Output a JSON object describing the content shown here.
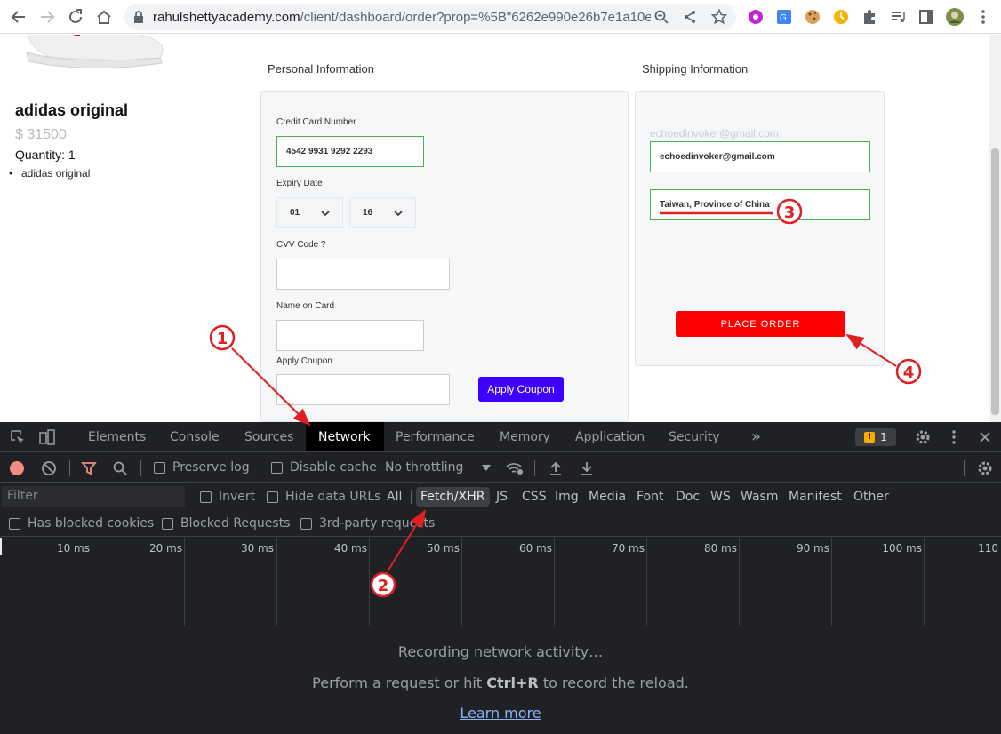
{
  "browser": {
    "url_host": "rahulshettyacademy.com",
    "url_path": "/client/dashboard/order?prop=%5B\"6262e990e26b7e1a10e..."
  },
  "product": {
    "name": "adidas original",
    "price": "$ 31500",
    "quantity": "Quantity: 1",
    "items": [
      "adidas original"
    ]
  },
  "personal": {
    "title": "Personal Information",
    "card_label": "Credit Card Number",
    "card_value": "4542 9931 9292 2293",
    "expiry_label": "Expiry Date",
    "expiry_month": "01",
    "expiry_year": "16",
    "cvv_label": "CVV Code ?",
    "name_label": "Name on Card",
    "coupon_label": "Apply Coupon",
    "apply_button": "Apply Coupon"
  },
  "shipping": {
    "title": "Shipping Information",
    "email_placeholder": "echoedinvoker@gmail.com",
    "email_value": "echoedinvoker@gmail.com",
    "country_value": "Taiwan, Province of China",
    "place_order": "PLACE ORDER"
  },
  "devtools": {
    "tabs": [
      "Elements",
      "Console",
      "Sources",
      "Network",
      "Performance",
      "Memory",
      "Application",
      "Security"
    ],
    "active_tab": "Network",
    "more_tabs": "»",
    "issues_count": "1",
    "preserve_log": "Preserve log",
    "disable_cache": "Disable cache",
    "throttling": "No throttling",
    "filter_placeholder": "Filter",
    "invert": "Invert",
    "hide_data_urls": "Hide data URLs",
    "types": [
      "All",
      "Fetch/XHR",
      "JS",
      "CSS",
      "Img",
      "Media",
      "Font",
      "Doc",
      "WS",
      "Wasm",
      "Manifest",
      "Other"
    ],
    "active_type": "Fetch/XHR",
    "has_blocked_cookies": "Has blocked cookies",
    "blocked_requests": "Blocked Requests",
    "third_party": "3rd-party requests",
    "timeline_ticks": [
      "10 ms",
      "20 ms",
      "30 ms",
      "40 ms",
      "50 ms",
      "60 ms",
      "70 ms",
      "80 ms",
      "90 ms",
      "100 ms",
      "110"
    ],
    "recording": "Recording network activity…",
    "hint_pre": "Perform a request or hit ",
    "hint_key": "Ctrl+R",
    "hint_post": " to record the reload.",
    "learn_more": "Learn more"
  },
  "annotations": [
    "1",
    "2",
    "3",
    "4"
  ],
  "colors": {
    "accent_blue": "#3d00ff",
    "place_order_red": "#ff0000",
    "annotation_red": "#e02020",
    "valid_green": "#4caf50"
  }
}
